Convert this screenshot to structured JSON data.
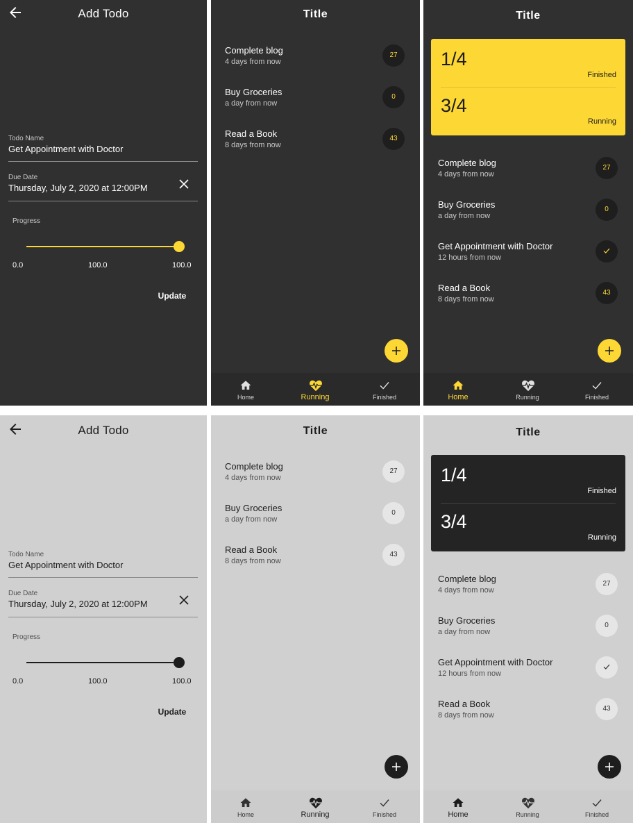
{
  "form": {
    "title": "Add Todo",
    "name_label": "Todo Name",
    "name_value": "Get Appointment with Doctor",
    "date_label": "Due Date",
    "date_value": "Thursday, July 2, 2020 at 12:00PM",
    "progress_label": "Progress",
    "progress_value": 1.0,
    "min_label": "0.0",
    "mid_label": "100.0",
    "max_label": "100.0",
    "update_label": "Update"
  },
  "running": {
    "title": "Title",
    "items": [
      {
        "title": "Complete blog",
        "subtitle": "4 days from now",
        "badge": "27"
      },
      {
        "title": "Buy Groceries",
        "subtitle": "a day from now",
        "badge": "0"
      },
      {
        "title": "Read a Book",
        "subtitle": "8 days from now",
        "badge": "43"
      }
    ]
  },
  "home": {
    "title": "Title",
    "stats": {
      "finished": "1/4",
      "finished_label": "Finished",
      "running": "3/4",
      "running_label": "Running"
    },
    "items": [
      {
        "title": "Complete blog",
        "subtitle": "4 days from now",
        "badge": "27"
      },
      {
        "title": "Buy Groceries",
        "subtitle": "a day from now",
        "badge": "0"
      },
      {
        "title": "Get Appointment with Doctor",
        "subtitle": "12 hours from now",
        "badge": "check-icon"
      },
      {
        "title": "Read a Book",
        "subtitle": "8 days from now",
        "badge": "43"
      }
    ]
  },
  "nav": {
    "home": "Home",
    "running": "Running",
    "finished": "Finished"
  },
  "colors": {
    "dark_bg": "#303030",
    "light_bg": "#d0d0d0",
    "accent": "#fdd835",
    "dark_badge": "#1e1e1e",
    "light_badge": "#e6e6e6"
  },
  "icons": {
    "back": "arrow-left-icon",
    "clear": "close-icon",
    "add": "plus-icon",
    "home": "home-icon",
    "running": "heartbeat-icon",
    "finished": "check-icon"
  }
}
